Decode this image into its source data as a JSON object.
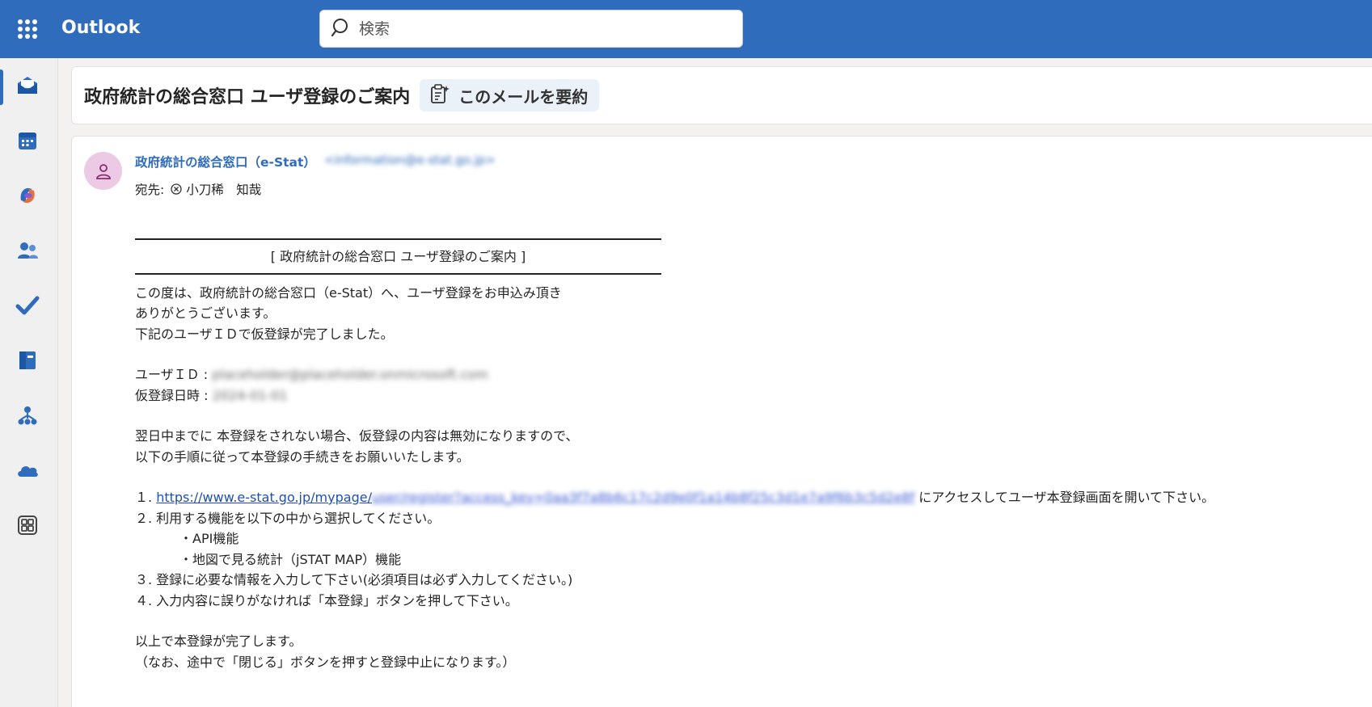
{
  "app": {
    "name": "Outlook"
  },
  "search": {
    "placeholder": "検索"
  },
  "rail": {
    "items": [
      {
        "name": "mail",
        "icon": "mail-icon",
        "active": true
      },
      {
        "name": "calendar",
        "icon": "calendar-icon"
      },
      {
        "name": "copilot",
        "icon": "copilot-icon"
      },
      {
        "name": "people",
        "icon": "people-icon"
      },
      {
        "name": "todo",
        "icon": "todo-check-icon"
      },
      {
        "name": "onenote",
        "icon": "notebook-icon"
      },
      {
        "name": "org",
        "icon": "org-chart-icon"
      },
      {
        "name": "onedrive",
        "icon": "cloud-icon"
      },
      {
        "name": "apps",
        "icon": "apps-grid-icon"
      }
    ]
  },
  "email": {
    "subject": "政府統計の総合窓口 ユーザ登録のご案内",
    "summarize_label": "このメールを要約",
    "sender_name": "政府統計の総合窓口（e-Stat）",
    "sender_email": "<information@e-stat.go.jp>",
    "to_label": "宛先:",
    "recipient": "小刀稀　知哉",
    "body": {
      "banner": "[ 政府統計の総合窓口 ユーザ登録のご案内 ]",
      "intro_1": "この度は、政府統計の総合窓口（e-Stat）へ、ユーザ登録をお申込み頂き",
      "intro_2": "ありがとうございます。",
      "intro_3": "下記のユーザＩＤで仮登録が完了しました。",
      "user_id_label": "ユーザＩＤ :",
      "user_id_value": "placeholder@placeholder.onmicrosoft.com",
      "reg_date_label": "仮登録日時 :",
      "reg_date_value": "2024-01-01",
      "notice_1": " 翌日中までに 本登録をされない場合、仮登録の内容は無効になりますので、",
      "notice_2": "以下の手順に従って本登録の手続きをお願いいたします。",
      "step1_num": "１. ",
      "step1_link": "https://www.e-stat.go.jp/mypage/",
      "step1_link_rest": "user/register?access_key=0aa3f7a8b6c17c2d9e0f1a14b8f25c3d1e7a9f6b3c5d2e8f",
      "step1_text": "にアクセスしてユーザ本登録画面を開いて下さい。",
      "step2": "２. 利用する機能を以下の中から選択してください。",
      "step2_opt1": "・API機能",
      "step2_opt2": "・地図で見る統計（jSTAT MAP）機能",
      "step3": "３. 登録に必要な情報を入力して下さい(必須項目は必ず入力してください。)",
      "step4": "４. 入力内容に誤りがなければ「本登録」ボタンを押して下さい。",
      "closing_1": "以上で本登録が完了します。",
      "closing_2": "（なお、途中で「閉じる」ボタンを押すと登録中止になります。）"
    }
  },
  "colors": {
    "brand": "#2f6cbb",
    "link": "#1f4fb5",
    "avatar_bg": "#ecc9e5"
  }
}
